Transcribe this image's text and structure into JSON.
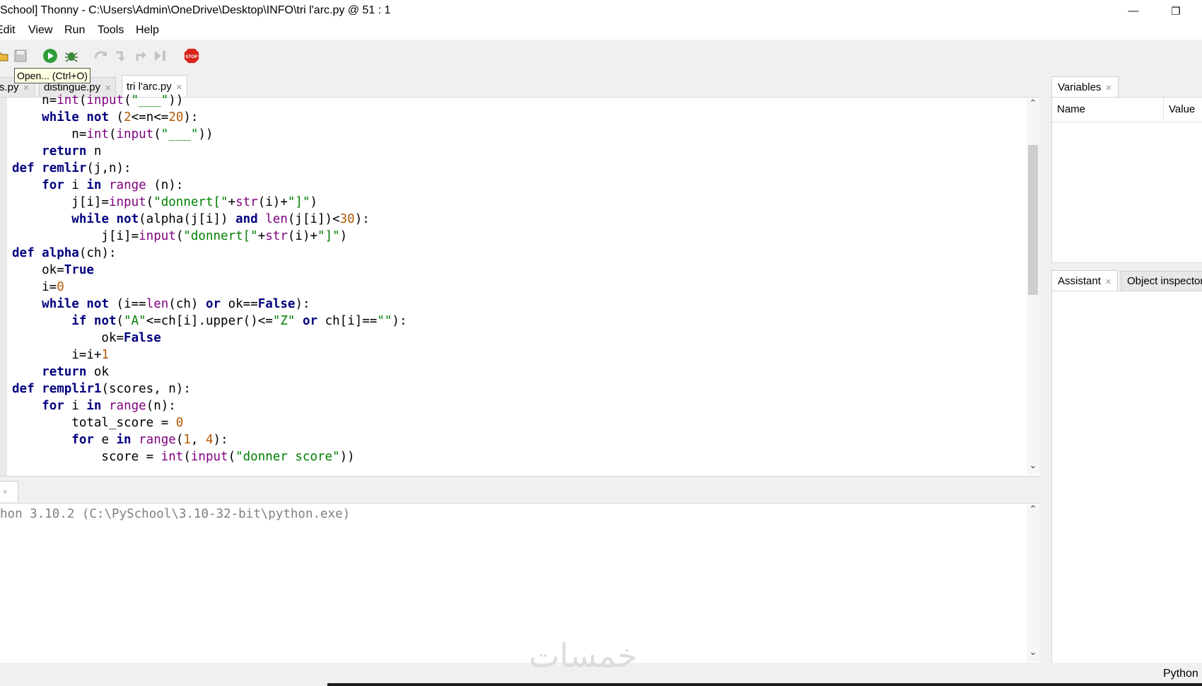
{
  "window": {
    "title": "School] Thonny  -  C:\\Users\\Admin\\OneDrive\\Desktop\\INFO\\tri l'arc.py  @  51 : 1",
    "minimize_glyph": "—",
    "restore_glyph": "❐"
  },
  "menu": {
    "items": [
      "Edit",
      "View",
      "Run",
      "Tools",
      "Help"
    ]
  },
  "toolbar": {
    "icons": [
      "open-icon",
      "save-icon",
      "run-icon",
      "debug-icon",
      "step-over-icon",
      "step-into-icon",
      "step-out-icon",
      "resume-icon",
      "stop-icon"
    ],
    "stop_label": "STOP",
    "tooltip": "Open... (Ctrl+O)",
    "colors": {
      "run": "#2e9e3a",
      "stop": "#d8241b"
    }
  },
  "editor": {
    "tabs": [
      {
        "label": "s.py",
        "active": false
      },
      {
        "label": "distingue.py",
        "active": false
      },
      {
        "label": "tri l'arc.py",
        "active": true
      }
    ],
    "lines": [
      "    n=int(input(\"___\"))",
      "    while not (2<=n<=20):",
      "        n=int(input(\"___\"))",
      "    return n",
      "def remlir(j,n):",
      "    for i in range (n):",
      "        j[i]=input(\"donnert[\"+str(i)+\"]\")",
      "        while not(alpha(j[i]) and len(j[i])<30):",
      "            j[i]=input(\"donnert[\"+str(i)+\"]\")",
      "def alpha(ch):",
      "    ok=True",
      "    i=0",
      "    while not (i==len(ch) or ok==False):",
      "        if not(\"A\"<=ch[i].upper()<=\"Z\" or ch[i]==\"\"):",
      "            ok=False",
      "        i=i+1",
      "    return ok",
      "def remplir1(scores, n):",
      "    for i in range(n):",
      "        total_score = 0",
      "        for e in range(1, 4):",
      "            score = int(input(\"donner score\"))"
    ]
  },
  "shell": {
    "tab_close": "×",
    "banner": "hon 3.10.2 (C:\\PySchool\\3.10-32-bit\\python.exe)"
  },
  "variables": {
    "tab_label": "Variables",
    "col_name": "Name",
    "col_value": "Value"
  },
  "assistant": {
    "tab_label": "Assistant",
    "object_tab_label": "Object inspector"
  },
  "status": {
    "language": "Python"
  },
  "watermark": "خمسات"
}
